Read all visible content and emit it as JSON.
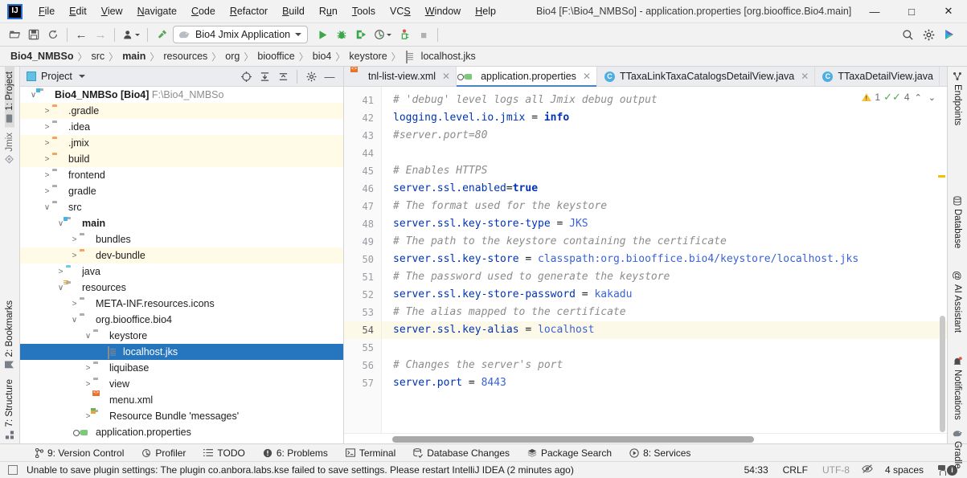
{
  "window": {
    "title": "Bio4 [F:\\Bio4_NMBSo] - application.properties [org.biooffice.Bio4.main]",
    "logo_text": "IJ",
    "controls": {
      "minimize": "—",
      "maximize": "□",
      "close": "✕"
    }
  },
  "menu": [
    {
      "label": "File"
    },
    {
      "label": "Edit"
    },
    {
      "label": "View"
    },
    {
      "label": "Navigate"
    },
    {
      "label": "Code"
    },
    {
      "label": "Refactor"
    },
    {
      "label": "Build"
    },
    {
      "label": "Run"
    },
    {
      "label": "Tools"
    },
    {
      "label": "VCS"
    },
    {
      "label": "Window"
    },
    {
      "label": "Help"
    }
  ],
  "toolbar": {
    "open_icon": "folder-open-icon",
    "save_icon": "save-icon",
    "sync_icon": "refresh-icon",
    "back_icon": "←",
    "forward_icon": "→",
    "profile_icon": "user-profile-icon",
    "build_icon": "hammer-icon",
    "run_config": "Bio4 Jmix Application",
    "run_icon": "▶",
    "debug_icon": "debug-bug-icon",
    "run_coverage_icon": "run-with-coverage-icon",
    "profiler_icon": "profiler-icon",
    "attach_icon": "attach-debugger-icon",
    "stop_icon": "■",
    "search_icon": "⌕",
    "settings_icon": "⚙",
    "ai_icon": "ai-assistant-icon"
  },
  "breadcrumb": {
    "items": [
      {
        "label": "Bio4_NMBSo",
        "bold": true
      },
      {
        "label": "src",
        "bold": false
      },
      {
        "label": "main",
        "bold": true
      },
      {
        "label": "resources",
        "bold": false
      },
      {
        "label": "org",
        "bold": false
      },
      {
        "label": "biooffice",
        "bold": false
      },
      {
        "label": "bio4",
        "bold": false
      },
      {
        "label": "keystore",
        "bold": false
      },
      {
        "label": "localhost.jks",
        "bold": false,
        "icon": "jks-file-icon"
      }
    ],
    "separator": "〉"
  },
  "left_strip": {
    "top": [
      {
        "label": "1: Project",
        "icon": "project-icon",
        "active": true
      },
      {
        "label": "Jmix",
        "icon": "jmix-icon",
        "active": false
      }
    ],
    "bottom": [
      {
        "label": "2: Bookmarks",
        "icon": "bookmark-icon"
      },
      {
        "label": "7: Structure",
        "icon": "structure-icon"
      }
    ]
  },
  "right_strip": {
    "items": [
      {
        "label": "Endpoints",
        "icon": "endpoints-icon"
      },
      {
        "label": "Database",
        "icon": "database-icon"
      },
      {
        "label": "AI Assistant",
        "icon": "ai-assistant-icon"
      },
      {
        "label": "Notifications",
        "icon": "notifications-bell-icon",
        "badge": true
      },
      {
        "label": "Gradle",
        "icon": "gradle-elephant-icon"
      }
    ]
  },
  "project_panel": {
    "title": "Project",
    "title_caret": "▾",
    "actions": [
      {
        "name": "select-opened-file-icon",
        "glyph": "⊕"
      },
      {
        "name": "expand-all-icon",
        "glyph": "⨗"
      },
      {
        "name": "collapse-all-icon",
        "glyph": "⨘"
      },
      {
        "name": "settings-gear-icon",
        "glyph": "⚙"
      },
      {
        "name": "hide-panel-icon",
        "glyph": "—"
      }
    ],
    "tree": [
      {
        "label": "Bio4_NMBSo",
        "bold_suffix": "[Bio4]",
        "dim_suffix": "F:\\Bio4_NMBSo",
        "indent": 0,
        "arrow": "open",
        "icon": "module-folder",
        "state": "normal"
      },
      {
        "label": ".gradle",
        "indent": 1,
        "arrow": "closed",
        "icon": "folder-orange",
        "state": "ignored"
      },
      {
        "label": ".idea",
        "indent": 1,
        "arrow": "closed",
        "icon": "folder-gray",
        "state": "normal"
      },
      {
        "label": ".jmix",
        "indent": 1,
        "arrow": "closed",
        "icon": "folder-orange",
        "state": "ignored"
      },
      {
        "label": "build",
        "indent": 1,
        "arrow": "closed",
        "icon": "folder-orange",
        "state": "ignored"
      },
      {
        "label": "frontend",
        "indent": 1,
        "arrow": "closed",
        "icon": "folder-gray",
        "state": "normal"
      },
      {
        "label": "gradle",
        "indent": 1,
        "arrow": "closed",
        "icon": "folder-gray",
        "state": "normal"
      },
      {
        "label": "src",
        "indent": 1,
        "arrow": "open",
        "icon": "folder-gray",
        "state": "normal"
      },
      {
        "label": "main",
        "indent": 2,
        "arrow": "open",
        "icon": "module-folder",
        "state": "normal",
        "bold": true
      },
      {
        "label": "bundles",
        "indent": 3,
        "arrow": "closed",
        "icon": "folder-gray",
        "state": "normal"
      },
      {
        "label": "dev-bundle",
        "indent": 3,
        "arrow": "closed",
        "icon": "folder-orange",
        "state": "ignored"
      },
      {
        "label": "java",
        "indent": 2,
        "arrow": "closed",
        "icon": "folder-blue",
        "state": "normal"
      },
      {
        "label": "resources",
        "indent": 2,
        "arrow": "open",
        "icon": "folder-resources",
        "state": "normal"
      },
      {
        "label": "META-INF.resources.icons",
        "indent": 3,
        "arrow": "closed",
        "icon": "folder-gray",
        "state": "normal"
      },
      {
        "label": "org.biooffice.bio4",
        "indent": 3,
        "arrow": "open",
        "icon": "folder-gray",
        "state": "normal"
      },
      {
        "label": "keystore",
        "indent": 4,
        "arrow": "open",
        "icon": "folder-gray",
        "state": "normal"
      },
      {
        "label": "localhost.jks",
        "indent": 5,
        "arrow": "none",
        "icon": "file-jks",
        "state": "selected"
      },
      {
        "label": "liquibase",
        "indent": 4,
        "arrow": "closed",
        "icon": "folder-gray",
        "state": "normal"
      },
      {
        "label": "view",
        "indent": 4,
        "arrow": "closed",
        "icon": "folder-gray",
        "state": "normal"
      },
      {
        "label": "menu.xml",
        "indent": 4,
        "arrow": "none",
        "icon": "file-xml",
        "state": "normal"
      },
      {
        "label": "Resource Bundle 'messages'",
        "indent": 4,
        "arrow": "closed",
        "icon": "folder-bundle",
        "state": "normal"
      },
      {
        "label": "application.properties",
        "indent": 3,
        "arrow": "none",
        "icon": "file-properties",
        "state": "normal"
      }
    ]
  },
  "editor": {
    "tabs": [
      {
        "label": "tnl-list-view.xml",
        "icon": "xml-file-icon",
        "active": false,
        "closable": true
      },
      {
        "label": "application.properties",
        "icon": "properties-file-icon",
        "active": true,
        "closable": true
      },
      {
        "label": "TTaxaLinkTaxaCatalogsDetailView.java",
        "icon": "java-class-icon",
        "active": false,
        "closable": true
      },
      {
        "label": "TTaxaDetailView.java",
        "icon": "java-class-icon",
        "active": false,
        "closable": false
      }
    ],
    "tab_overflow_icon": "⌄",
    "tab_menu_icon": "⋮",
    "tab_endpoints_icon": "endpoints-icon",
    "inspections": {
      "warning_count": "1",
      "ok_count": "4",
      "warning_icon": "warning-triangle-icon",
      "ok_icon": "inspection-ok-icon",
      "prev_icon": "⌃",
      "next_icon": "⌄"
    },
    "first_line_number": 41,
    "lines": [
      {
        "n": 41,
        "current": false,
        "tokens": [
          {
            "t": "# 'debug' level logs all Jmix debug output",
            "c": "cm"
          }
        ]
      },
      {
        "n": 42,
        "current": false,
        "tokens": [
          {
            "t": "logging.level.io.jmix",
            "c": "key"
          },
          {
            "t": " = ",
            "c": "eq"
          },
          {
            "t": "info",
            "c": "kb"
          }
        ]
      },
      {
        "n": 43,
        "current": false,
        "tokens": [
          {
            "t": "#server.port=80",
            "c": "cm"
          }
        ]
      },
      {
        "n": 44,
        "current": false,
        "tokens": []
      },
      {
        "n": 45,
        "current": false,
        "tokens": [
          {
            "t": "# Enables HTTPS",
            "c": "cm"
          }
        ]
      },
      {
        "n": 46,
        "current": false,
        "tokens": [
          {
            "t": "server.ssl.enabled",
            "c": "key"
          },
          {
            "t": "=",
            "c": "eq"
          },
          {
            "t": "true",
            "c": "kb"
          }
        ]
      },
      {
        "n": 47,
        "current": false,
        "tokens": [
          {
            "t": "# The format used for the keystore",
            "c": "cm"
          }
        ]
      },
      {
        "n": 48,
        "current": false,
        "tokens": [
          {
            "t": "server.ssl.key-store-type",
            "c": "key"
          },
          {
            "t": " = ",
            "c": "eq"
          },
          {
            "t": "JKS",
            "c": "val"
          }
        ]
      },
      {
        "n": 49,
        "current": false,
        "tokens": [
          {
            "t": "# The path to the keystore containing the certificate",
            "c": "cm"
          }
        ]
      },
      {
        "n": 50,
        "current": false,
        "tokens": [
          {
            "t": "server.ssl.key-store",
            "c": "key"
          },
          {
            "t": " = ",
            "c": "eq"
          },
          {
            "t": "classpath:org.biooffice.bio4/keystore/localhost.jks",
            "c": "val"
          }
        ]
      },
      {
        "n": 51,
        "current": false,
        "tokens": [
          {
            "t": "# The password used to generate the keystore",
            "c": "cm"
          }
        ]
      },
      {
        "n": 52,
        "current": false,
        "tokens": [
          {
            "t": "server.ssl.key-store-password",
            "c": "key"
          },
          {
            "t": " = ",
            "c": "eq"
          },
          {
            "t": "kakadu",
            "c": "val"
          }
        ]
      },
      {
        "n": 53,
        "current": false,
        "tokens": [
          {
            "t": "# The alias mapped to the certificate",
            "c": "cm"
          }
        ]
      },
      {
        "n": 54,
        "current": true,
        "tokens": [
          {
            "t": "server.ssl.key-alias",
            "c": "key"
          },
          {
            "t": " = ",
            "c": "eq"
          },
          {
            "t": "localhost",
            "c": "val"
          }
        ]
      },
      {
        "n": 55,
        "current": false,
        "tokens": []
      },
      {
        "n": 56,
        "current": false,
        "tokens": [
          {
            "t": "# Changes the server's port",
            "c": "cm"
          }
        ]
      },
      {
        "n": 57,
        "current": false,
        "tokens": [
          {
            "t": "server.port",
            "c": "key"
          },
          {
            "t": " = ",
            "c": "eq"
          },
          {
            "t": "8443",
            "c": "val"
          }
        ]
      }
    ]
  },
  "bottom_bar": [
    {
      "label": "9: Version Control",
      "icon": "branch-icon",
      "mnemonic": "9"
    },
    {
      "label": "Profiler",
      "icon": "profiler-icon"
    },
    {
      "label": "TODO",
      "icon": "todo-list-icon"
    },
    {
      "label": "6: Problems",
      "icon": "problems-icon",
      "mnemonic": "6"
    },
    {
      "label": "Terminal",
      "icon": "terminal-icon"
    },
    {
      "label": "Database Changes",
      "icon": "database-changes-icon"
    },
    {
      "label": "Package Search",
      "icon": "package-search-icon"
    },
    {
      "label": "8: Services",
      "icon": "services-icon",
      "mnemonic": "8"
    }
  ],
  "status_bar": {
    "message": "Unable to save plugin settings: The plugin co.anbora.labs.kse failed to save settings. Please restart IntelliJ IDEA (2 minutes ago)",
    "message_icon": "message-balloon-icon",
    "caret_position": "54:33",
    "line_separator": "CRLF",
    "encoding": "UTF-8",
    "reader_mode_icon": "reader-mode-off-icon",
    "indent": "4 spaces",
    "lock_icon": "unlocked-icon",
    "info_icon": "event-log-icon"
  },
  "colors": {
    "accent_blue": "#2675bf",
    "ignored_yellow": "#fffbe6",
    "current_line": "#fdf9e8",
    "comment_gray": "#8c8c8c",
    "key_blue": "#0033b3",
    "value_blue": "#3a62d6",
    "chrome_gray": "#f2f2f2"
  }
}
